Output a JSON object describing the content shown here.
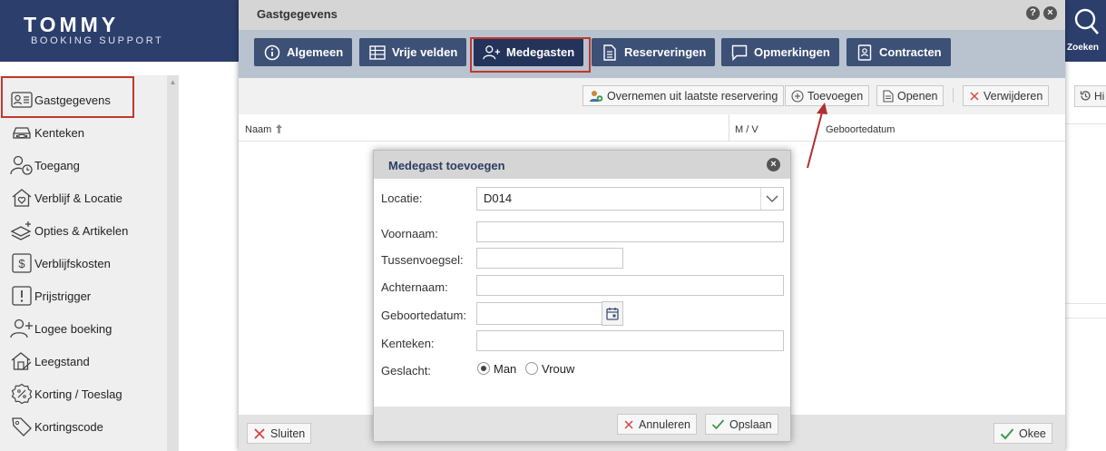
{
  "brand": {
    "logo": "TOMMY",
    "subtitle": "BOOKING SUPPORT"
  },
  "search": {
    "label": "Zoeken"
  },
  "sidebar": {
    "items": [
      {
        "label": "Gastgegevens",
        "icon": "guest-card-icon"
      },
      {
        "label": "Kenteken",
        "icon": "car-icon"
      },
      {
        "label": "Toegang",
        "icon": "access-user-clock-icon"
      },
      {
        "label": "Verblijf & Locatie",
        "icon": "house-heart-icon"
      },
      {
        "label": "Opties & Artikelen",
        "icon": "options-stack-icon"
      },
      {
        "label": "Verblijfskosten",
        "icon": "dollar-icon"
      },
      {
        "label": "Prijstrigger",
        "icon": "exclamation-icon"
      },
      {
        "label": "Logee boeking",
        "icon": "user-plus-icon"
      },
      {
        "label": "Leegstand",
        "icon": "house-empty-icon"
      },
      {
        "label": "Korting / Toeslag",
        "icon": "percent-badge-icon"
      },
      {
        "label": "Kortingscode",
        "icon": "tag-icon"
      }
    ]
  },
  "right_toolbar": {
    "history_label": "Hi"
  },
  "modal": {
    "title": "Gastgegevens",
    "help": "?",
    "close": "×",
    "tabs": [
      {
        "label": "Algemeen",
        "icon": "info-icon"
      },
      {
        "label": "Vrije velden",
        "icon": "grid-icon"
      },
      {
        "label": "Medegasten",
        "icon": "user-plus-icon",
        "active": true
      },
      {
        "label": "Reserveringen",
        "icon": "document-icon"
      },
      {
        "label": "Opmerkingen",
        "icon": "comment-icon"
      },
      {
        "label": "Contracten",
        "icon": "contract-icon"
      }
    ],
    "toolbar": {
      "copy_label": "Overnemen uit laatste reservering",
      "add_label": "Toevoegen",
      "open_label": "Openen",
      "delete_label": "Verwijderen"
    },
    "table": {
      "columns": [
        "Naam",
        "M / V",
        "Geboortedatum"
      ]
    },
    "footer": {
      "close_label": "Sluiten",
      "ok_label": "Okee"
    }
  },
  "dialog": {
    "title": "Medegast toevoegen",
    "close": "×",
    "fields": {
      "locatie": {
        "label": "Locatie:",
        "value": "D014"
      },
      "voornaam": {
        "label": "Voornaam:",
        "value": ""
      },
      "tussenvoegsel": {
        "label": "Tussenvoegsel:",
        "value": ""
      },
      "achternaam": {
        "label": "Achternaam:",
        "value": ""
      },
      "geboortedatum": {
        "label": "Geboortedatum:",
        "value": ""
      },
      "kenteken": {
        "label": "Kenteken:",
        "value": ""
      },
      "geslacht": {
        "label": "Geslacht:",
        "options": [
          "Man",
          "Vrouw"
        ],
        "selected": "Man"
      }
    },
    "cancel_label": "Annuleren",
    "save_label": "Opslaan"
  },
  "colors": {
    "brand": "#2c3e6b",
    "tab": "#3d5076",
    "tab_active": "#24335a",
    "highlight": "#c0392b"
  }
}
